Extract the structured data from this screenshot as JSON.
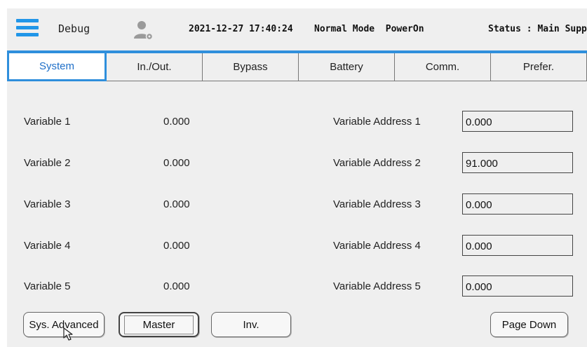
{
  "header": {
    "debug_label": "Debug",
    "datetime": "2021-12-27 17:40:24",
    "mode": "Normal Mode  PowerOn",
    "status": "Status : Main Supply"
  },
  "tabs": [
    {
      "label": "System",
      "active": true
    },
    {
      "label": "In./Out.",
      "active": false
    },
    {
      "label": "Bypass",
      "active": false
    },
    {
      "label": "Battery",
      "active": false
    },
    {
      "label": "Comm.",
      "active": false
    },
    {
      "label": "Prefer.",
      "active": false
    }
  ],
  "variables": [
    {
      "label": "Variable 1",
      "value": "0.000",
      "address_label": "Variable Address 1",
      "address_value": "0.000"
    },
    {
      "label": "Variable 2",
      "value": "0.000",
      "address_label": "Variable Address 2",
      "address_value": "91.000"
    },
    {
      "label": "Variable 3",
      "value": "0.000",
      "address_label": "Variable Address 3",
      "address_value": "0.000"
    },
    {
      "label": "Variable 4",
      "value": "0.000",
      "address_label": "Variable Address 4",
      "address_value": "0.000"
    },
    {
      "label": "Variable 5",
      "value": "0.000",
      "address_label": "Variable Address 5",
      "address_value": "0.000"
    }
  ],
  "buttons": {
    "sys_advanced": "Sys. Advanced",
    "master": "Master",
    "inv": "Inv.",
    "page_down": "Page Down"
  },
  "colors": {
    "accent": "#2f8fdc",
    "active_tab_text": "#1e6fc8",
    "background": "#efefef"
  },
  "icons": [
    "menu-icon",
    "user-settings-icon",
    "mouse-pointer-icon"
  ]
}
